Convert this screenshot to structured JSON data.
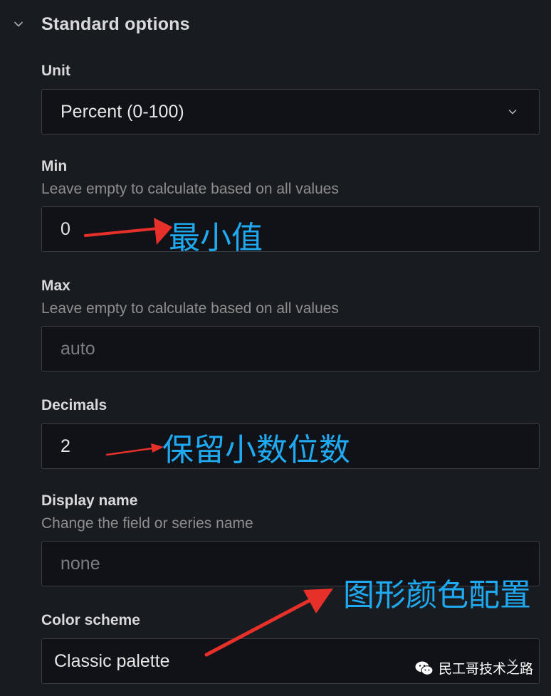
{
  "section": {
    "title": "Standard options"
  },
  "unit": {
    "label": "Unit",
    "value": "Percent (0-100)"
  },
  "min": {
    "label": "Min",
    "description": "Leave empty to calculate based on all values",
    "value": "0"
  },
  "max": {
    "label": "Max",
    "description": "Leave empty to calculate based on all values",
    "placeholder": "auto"
  },
  "decimals": {
    "label": "Decimals",
    "value": "2"
  },
  "display_name": {
    "label": "Display name",
    "description": "Change the field or series name",
    "placeholder": "none"
  },
  "color_scheme": {
    "label": "Color scheme",
    "value": "Classic palette"
  },
  "annotations": {
    "min": "最小值",
    "decimals": "保留小数位数",
    "color": "图形颜色配置"
  },
  "watermark": {
    "text": "民工哥技术之路"
  },
  "colors": {
    "background": "#181b1f",
    "annotation": "#1fa9f0",
    "arrow": "#e8302a"
  },
  "icons": {
    "section_toggle": "chevron-down-icon",
    "select": "chevron-down-icon",
    "watermark": "wechat-icon"
  }
}
